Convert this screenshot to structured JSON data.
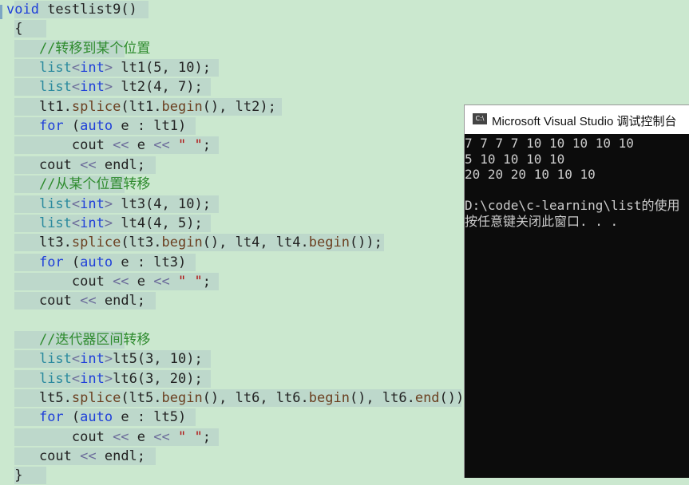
{
  "editor": {
    "lines": [
      [
        {
          "t": "void",
          "c": "kw"
        },
        {
          "t": " testlist9()",
          "c": "tx"
        }
      ],
      [
        {
          "t": " {",
          "c": "tx"
        }
      ],
      [
        {
          "t": "    //转移到某个位置",
          "c": "cm"
        }
      ],
      [
        {
          "t": "    ",
          "c": "tx"
        },
        {
          "t": "list",
          "c": "tp"
        },
        {
          "t": "<",
          "c": "op"
        },
        {
          "t": "int",
          "c": "kw"
        },
        {
          "t": ">",
          "c": "op"
        },
        {
          "t": " lt1(5, 10);",
          "c": "tx"
        }
      ],
      [
        {
          "t": "    ",
          "c": "tx"
        },
        {
          "t": "list",
          "c": "tp"
        },
        {
          "t": "<",
          "c": "op"
        },
        {
          "t": "int",
          "c": "kw"
        },
        {
          "t": ">",
          "c": "op"
        },
        {
          "t": " lt2(4, 7);",
          "c": "tx"
        }
      ],
      [
        {
          "t": "    lt1.",
          "c": "tx"
        },
        {
          "t": "splice",
          "c": "fn"
        },
        {
          "t": "(lt1.",
          "c": "tx"
        },
        {
          "t": "begin",
          "c": "fn"
        },
        {
          "t": "(), lt2);",
          "c": "tx"
        }
      ],
      [
        {
          "t": "    ",
          "c": "tx"
        },
        {
          "t": "for",
          "c": "kw"
        },
        {
          "t": " (",
          "c": "tx"
        },
        {
          "t": "auto",
          "c": "kw"
        },
        {
          "t": " e : lt1)",
          "c": "tx"
        }
      ],
      [
        {
          "t": "        cout ",
          "c": "tx"
        },
        {
          "t": "<<",
          "c": "op"
        },
        {
          "t": " e ",
          "c": "tx"
        },
        {
          "t": "<<",
          "c": "op"
        },
        {
          "t": " ",
          "c": "tx"
        },
        {
          "t": "\" \"",
          "c": "str"
        },
        {
          "t": ";",
          "c": "tx"
        }
      ],
      [
        {
          "t": "    cout ",
          "c": "tx"
        },
        {
          "t": "<<",
          "c": "op"
        },
        {
          "t": " endl;",
          "c": "tx"
        }
      ],
      [
        {
          "t": "    //从某个位置转移",
          "c": "cm"
        }
      ],
      [
        {
          "t": "    ",
          "c": "tx"
        },
        {
          "t": "list",
          "c": "tp"
        },
        {
          "t": "<",
          "c": "op"
        },
        {
          "t": "int",
          "c": "kw"
        },
        {
          "t": ">",
          "c": "op"
        },
        {
          "t": " lt3(4, 10);",
          "c": "tx"
        }
      ],
      [
        {
          "t": "    ",
          "c": "tx"
        },
        {
          "t": "list",
          "c": "tp"
        },
        {
          "t": "<",
          "c": "op"
        },
        {
          "t": "int",
          "c": "kw"
        },
        {
          "t": ">",
          "c": "op"
        },
        {
          "t": " lt4(4, 5);",
          "c": "tx"
        }
      ],
      [
        {
          "t": "    lt3.",
          "c": "tx"
        },
        {
          "t": "splice",
          "c": "fn"
        },
        {
          "t": "(lt3.",
          "c": "tx"
        },
        {
          "t": "begin",
          "c": "fn"
        },
        {
          "t": "(), lt4, lt4.",
          "c": "tx"
        },
        {
          "t": "begin",
          "c": "fn"
        },
        {
          "t": "());",
          "c": "tx"
        }
      ],
      [
        {
          "t": "    ",
          "c": "tx"
        },
        {
          "t": "for",
          "c": "kw"
        },
        {
          "t": " (",
          "c": "tx"
        },
        {
          "t": "auto",
          "c": "kw"
        },
        {
          "t": " e : lt3)",
          "c": "tx"
        }
      ],
      [
        {
          "t": "        cout ",
          "c": "tx"
        },
        {
          "t": "<<",
          "c": "op"
        },
        {
          "t": " e ",
          "c": "tx"
        },
        {
          "t": "<<",
          "c": "op"
        },
        {
          "t": " ",
          "c": "tx"
        },
        {
          "t": "\" \"",
          "c": "str"
        },
        {
          "t": ";",
          "c": "tx"
        }
      ],
      [
        {
          "t": "    cout ",
          "c": "tx"
        },
        {
          "t": "<<",
          "c": "op"
        },
        {
          "t": " endl;",
          "c": "tx"
        }
      ],
      [
        {
          "t": "",
          "c": "tx"
        }
      ],
      [
        {
          "t": "    //迭代器区间转移",
          "c": "cm"
        }
      ],
      [
        {
          "t": "    ",
          "c": "tx"
        },
        {
          "t": "list",
          "c": "tp"
        },
        {
          "t": "<",
          "c": "op"
        },
        {
          "t": "int",
          "c": "kw"
        },
        {
          "t": ">",
          "c": "op"
        },
        {
          "t": "lt5(3, 10);",
          "c": "tx"
        }
      ],
      [
        {
          "t": "    ",
          "c": "tx"
        },
        {
          "t": "list",
          "c": "tp"
        },
        {
          "t": "<",
          "c": "op"
        },
        {
          "t": "int",
          "c": "kw"
        },
        {
          "t": ">",
          "c": "op"
        },
        {
          "t": "lt6(3, 20);",
          "c": "tx"
        }
      ],
      [
        {
          "t": "    lt5.",
          "c": "tx"
        },
        {
          "t": "splice",
          "c": "fn"
        },
        {
          "t": "(lt5.",
          "c": "tx"
        },
        {
          "t": "begin",
          "c": "fn"
        },
        {
          "t": "(), lt6, lt6.",
          "c": "tx"
        },
        {
          "t": "begin",
          "c": "fn"
        },
        {
          "t": "(), lt6.",
          "c": "tx"
        },
        {
          "t": "end",
          "c": "fn"
        },
        {
          "t": "());",
          "c": "tx"
        }
      ],
      [
        {
          "t": "    ",
          "c": "tx"
        },
        {
          "t": "for",
          "c": "kw"
        },
        {
          "t": " (",
          "c": "tx"
        },
        {
          "t": "auto",
          "c": "kw"
        },
        {
          "t": " e : lt5)",
          "c": "tx"
        }
      ],
      [
        {
          "t": "        cout ",
          "c": "tx"
        },
        {
          "t": "<<",
          "c": "op"
        },
        {
          "t": " e ",
          "c": "tx"
        },
        {
          "t": "<<",
          "c": "op"
        },
        {
          "t": " ",
          "c": "tx"
        },
        {
          "t": "\" \"",
          "c": "str"
        },
        {
          "t": ";",
          "c": "tx"
        }
      ],
      [
        {
          "t": "    cout ",
          "c": "tx"
        },
        {
          "t": "<<",
          "c": "op"
        },
        {
          "t": " endl;",
          "c": "tx"
        }
      ],
      [
        {
          "t": " }",
          "c": "tx"
        }
      ]
    ]
  },
  "console": {
    "title": "Microsoft Visual Studio 调试控制台",
    "icon": "console-app-icon",
    "output": [
      "7 7 7 7 10 10 10 10 10",
      "5 10 10 10 10",
      "20 20 20 10 10 10",
      "",
      "D:\\code\\c-learning\\list的使用",
      "按任意键关闭此窗口. . ."
    ]
  },
  "colors": {
    "editor_bg": "#cbe8cf",
    "keyword": "#1f3fd9",
    "type": "#2b8a9e",
    "comment": "#2e8b2e",
    "function": "#6b3f20",
    "string": "#b01515",
    "console_bg": "#0c0c0c",
    "console_text": "#cccccc"
  }
}
